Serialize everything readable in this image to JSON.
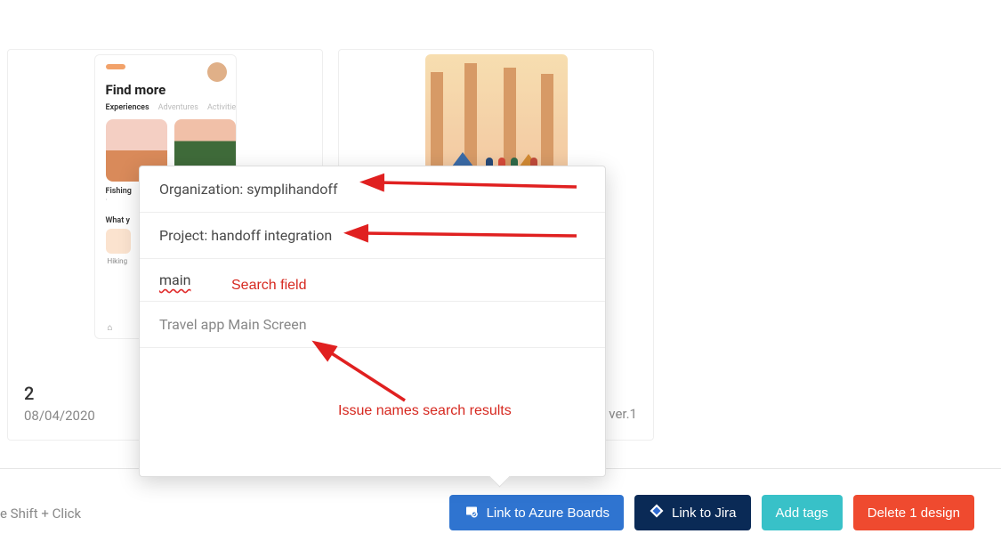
{
  "cards": [
    {
      "number": "2",
      "date": "08/04/2020",
      "thumb": {
        "title": "Find more",
        "tabs": [
          "Experiences",
          "Adventures",
          "Activities"
        ],
        "caption": "Fishing",
        "what": "What y",
        "chipcap": "Hiking"
      }
    },
    {
      "version": "ver.1"
    }
  ],
  "dropdown": {
    "organization_label": "Organization: symplihandoff",
    "project_label": "Project: handoff integration",
    "search_query": "main",
    "result": "Travel app Main Screen"
  },
  "annotations": {
    "search_field": "Search field",
    "results": "Issue names search results"
  },
  "bottom": {
    "hint": "e Shift + Click",
    "azure": "Link to Azure Boards",
    "jira": "Link to Jira",
    "tags": "Add tags",
    "delete": "Delete 1 design"
  }
}
